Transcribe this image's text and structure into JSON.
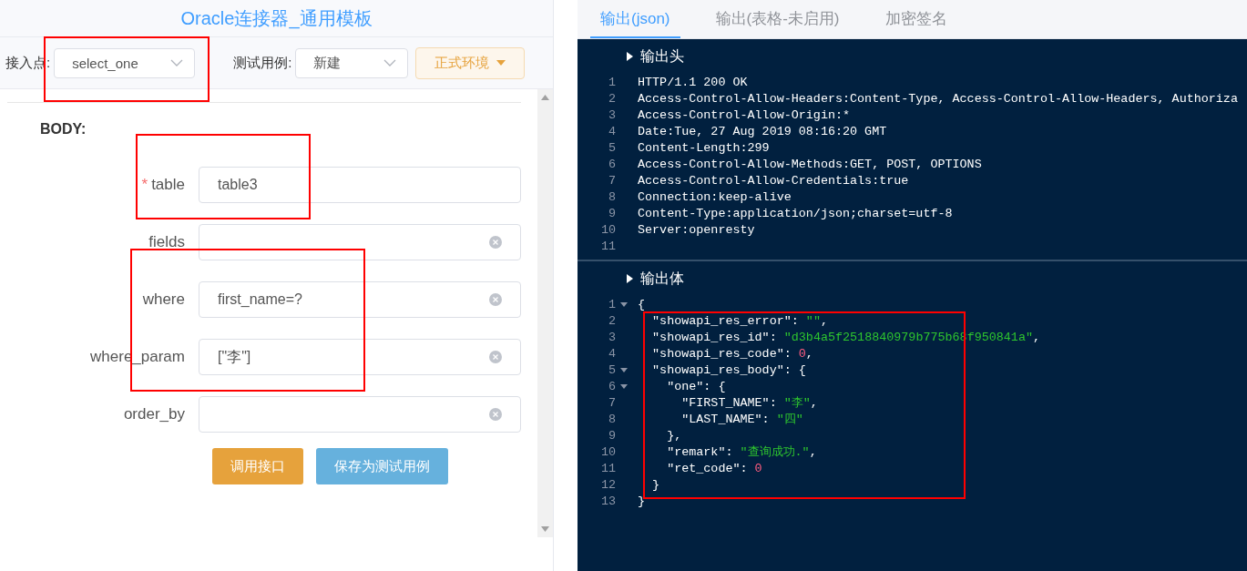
{
  "title": "Oracle连接器_通用模板",
  "toolbar": {
    "entry_label": "接入点:",
    "entry_select": {
      "value": "select_one",
      "highlighted": true
    },
    "case_label": "测试用例:",
    "case_select": {
      "value": "新建"
    },
    "env_button": "正式环境"
  },
  "section_title": "BODY:",
  "required_symbol": "*",
  "field_groups": [
    {
      "highlighted": true,
      "fields": [
        {
          "label": "table",
          "required": true,
          "value": "table3",
          "clearable": false
        }
      ]
    },
    {
      "highlighted": false,
      "fields": [
        {
          "label": "fields",
          "required": false,
          "clearable": true
        }
      ]
    },
    {
      "highlighted": true,
      "fields": [
        {
          "label": "where",
          "required": false,
          "value": "first_name=?",
          "clearable": true
        },
        {
          "label": "where_param",
          "required": false,
          "value": "[\"李\"]",
          "clearable": true
        }
      ]
    },
    {
      "highlighted": false,
      "fields": [
        {
          "label": "order_by",
          "required": false,
          "clearable": true
        }
      ]
    }
  ],
  "buttons": [
    {
      "label": "调用接口",
      "kind": "primary"
    },
    {
      "label": "保存为测试用例",
      "kind": "secondary"
    }
  ],
  "tabs": [
    {
      "label": "输出(json)",
      "selected": true
    },
    {
      "label": "输出(表格-未启用)",
      "selected": false
    },
    {
      "label": "加密签名",
      "selected": false
    }
  ],
  "sections": [
    {
      "title": "输出头",
      "kind": "headers",
      "blocks": [
        {
          "highlighted": false,
          "lines": [
            {
              "number": "1",
              "text": "HTTP/1.1 200 OK",
              "foldable": false
            },
            {
              "number": "2",
              "text": "Access-Control-Allow-Headers:Content-Type, Access-Control-Allow-Headers, Authoriza",
              "foldable": false
            },
            {
              "number": "3",
              "text": "Access-Control-Allow-Origin:*",
              "foldable": false
            },
            {
              "number": "4",
              "text": "Date:Tue, 27 Aug 2019 08:16:20 GMT",
              "foldable": false
            },
            {
              "number": "5",
              "text": "Content-Length:299",
              "foldable": false
            },
            {
              "number": "6",
              "text": "Access-Control-Allow-Methods:GET, POST, OPTIONS",
              "foldable": false
            },
            {
              "number": "7",
              "text": "Access-Control-Allow-Credentials:true",
              "foldable": false
            },
            {
              "number": "8",
              "text": "Connection:keep-alive",
              "foldable": false
            },
            {
              "number": "9",
              "text": "Content-Type:application/json;charset=utf-8",
              "foldable": false
            },
            {
              "number": "10",
              "text": "Server:openresty",
              "foldable": false
            },
            {
              "number": "11",
              "foldable": false
            }
          ]
        }
      ]
    },
    {
      "title": "输出体",
      "kind": "json",
      "blocks": [
        {
          "highlighted": false,
          "lines": [
            {
              "number": "1",
              "text": "{",
              "foldable": true
            }
          ]
        },
        {
          "highlighted": true,
          "lines": [
            {
              "number": "2",
              "text": "  \"showapi_res_error\": \"\",",
              "foldable": false
            },
            {
              "number": "3",
              "text": "  \"showapi_res_id\": \"d3b4a5f2518840979b775b68f950841a\",",
              "foldable": false
            },
            {
              "number": "4",
              "text": "  \"showapi_res_code\": 0,",
              "foldable": false
            },
            {
              "number": "5",
              "text": "  \"showapi_res_body\": {",
              "foldable": true
            },
            {
              "number": "6",
              "text": "    \"one\": {",
              "foldable": true
            },
            {
              "number": "7",
              "text": "      \"FIRST_NAME\": \"李\",",
              "foldable": false
            },
            {
              "number": "8",
              "text": "      \"LAST_NAME\": \"四\"",
              "foldable": false
            },
            {
              "number": "9",
              "text": "    },",
              "foldable": false
            },
            {
              "number": "10",
              "text": "    \"remark\": \"查询成功.\",",
              "foldable": false
            },
            {
              "number": "11",
              "text": "    \"ret_code\": 0",
              "foldable": false
            },
            {
              "number": "12",
              "text": "  }",
              "foldable": false
            }
          ]
        },
        {
          "highlighted": false,
          "lines": [
            {
              "number": "13",
              "text": "}",
              "foldable": false
            }
          ]
        }
      ]
    }
  ]
}
